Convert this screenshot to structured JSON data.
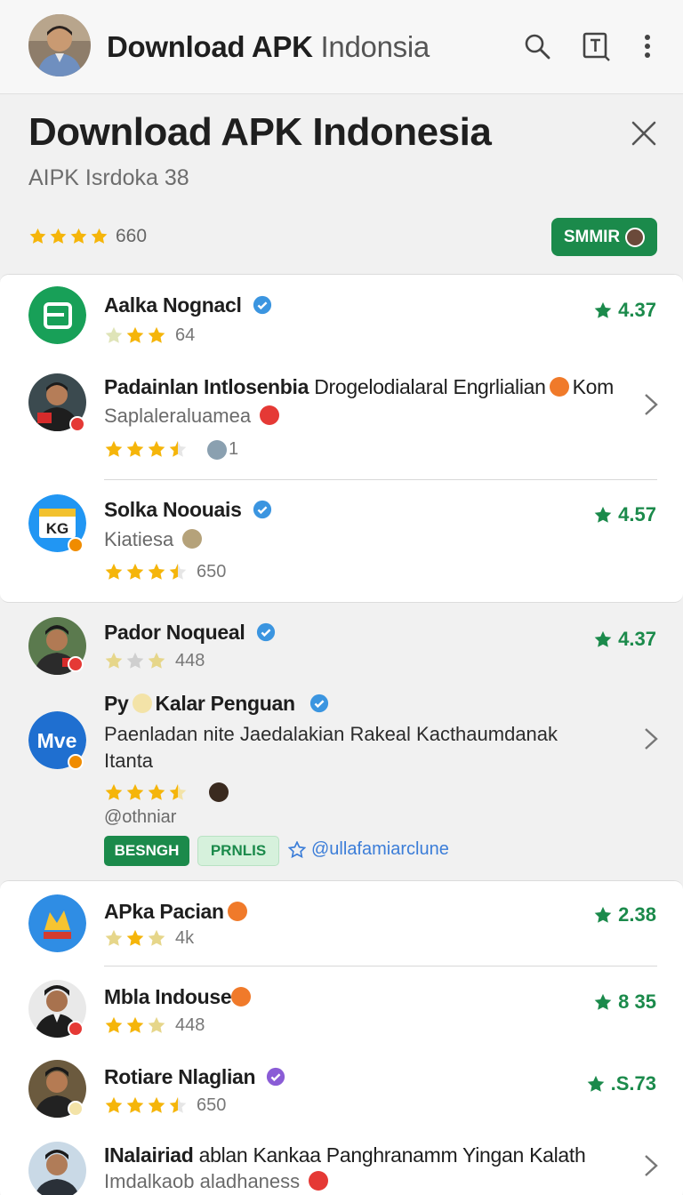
{
  "appbar": {
    "title_bold": "Download APK",
    "title_light": "Indonsia",
    "icons": [
      "search-icon",
      "text-format-icon",
      "more-vert-icon"
    ]
  },
  "header": {
    "title": "Download APK Indonesia",
    "subtitle": "AIPK Isrdoka 38",
    "rating_count": "660",
    "rating_stars": 4,
    "submit_label": "SMMIR"
  },
  "colors": {
    "accent": "#1b8a4b",
    "star": "#f5b50a",
    "verified": "#3b95e0",
    "link": "#3b7dd8"
  },
  "apps": [
    {
      "name": "Aalka Nognacl",
      "rating_count": "64",
      "score": "4.37",
      "stars": 3,
      "verified": true
    },
    {
      "name": "Padainlan Intlosenbia",
      "name_rest": "Drogelodialaral Engrlialian",
      "name_tail": "Kom",
      "desc": "Saplaleraluamea",
      "rating_count": "1",
      "stars": 3.5,
      "has_chevron": true
    },
    {
      "name": "Solka Noouais",
      "desc": "Kiatiesa",
      "rating_count": "650",
      "score": "4.57",
      "stars": 3.5,
      "verified": true,
      "logo_text": "KG"
    },
    {
      "name": "Pador Noqueal",
      "rating_count": "448",
      "score": "4.37",
      "stars": 3,
      "verified": true
    },
    {
      "name_pre": "Py",
      "name": "Kalar Penguan",
      "desc_line1": "Paenladan nite Jaedalakian Rakeal Kacthaumdanak",
      "desc_line2": "Itanta",
      "handle": "@othniar",
      "stars": 3.5,
      "verified": true,
      "logo_text": "Mve",
      "has_chevron": true,
      "chips": [
        "BESNGH",
        "PRNLIS"
      ],
      "link": "@ullafamiarclune"
    },
    {
      "name": "APka Pacian",
      "rating_count": "4k",
      "score": "2.38",
      "stars": 3
    },
    {
      "name": "Mbla Indouse",
      "rating_count": "448",
      "score": "8 35",
      "stars": 3
    },
    {
      "name": "Rotiare Nlaglian",
      "rating_count": "650",
      "score": ".S.73",
      "stars": 3.5,
      "verified": true
    },
    {
      "name": "INalairiad",
      "name_rest": "ablan Kankaa Panghranamm Yingan Kalath",
      "desc": "Imdalkaob aladhaness",
      "has_chevron": true
    }
  ]
}
